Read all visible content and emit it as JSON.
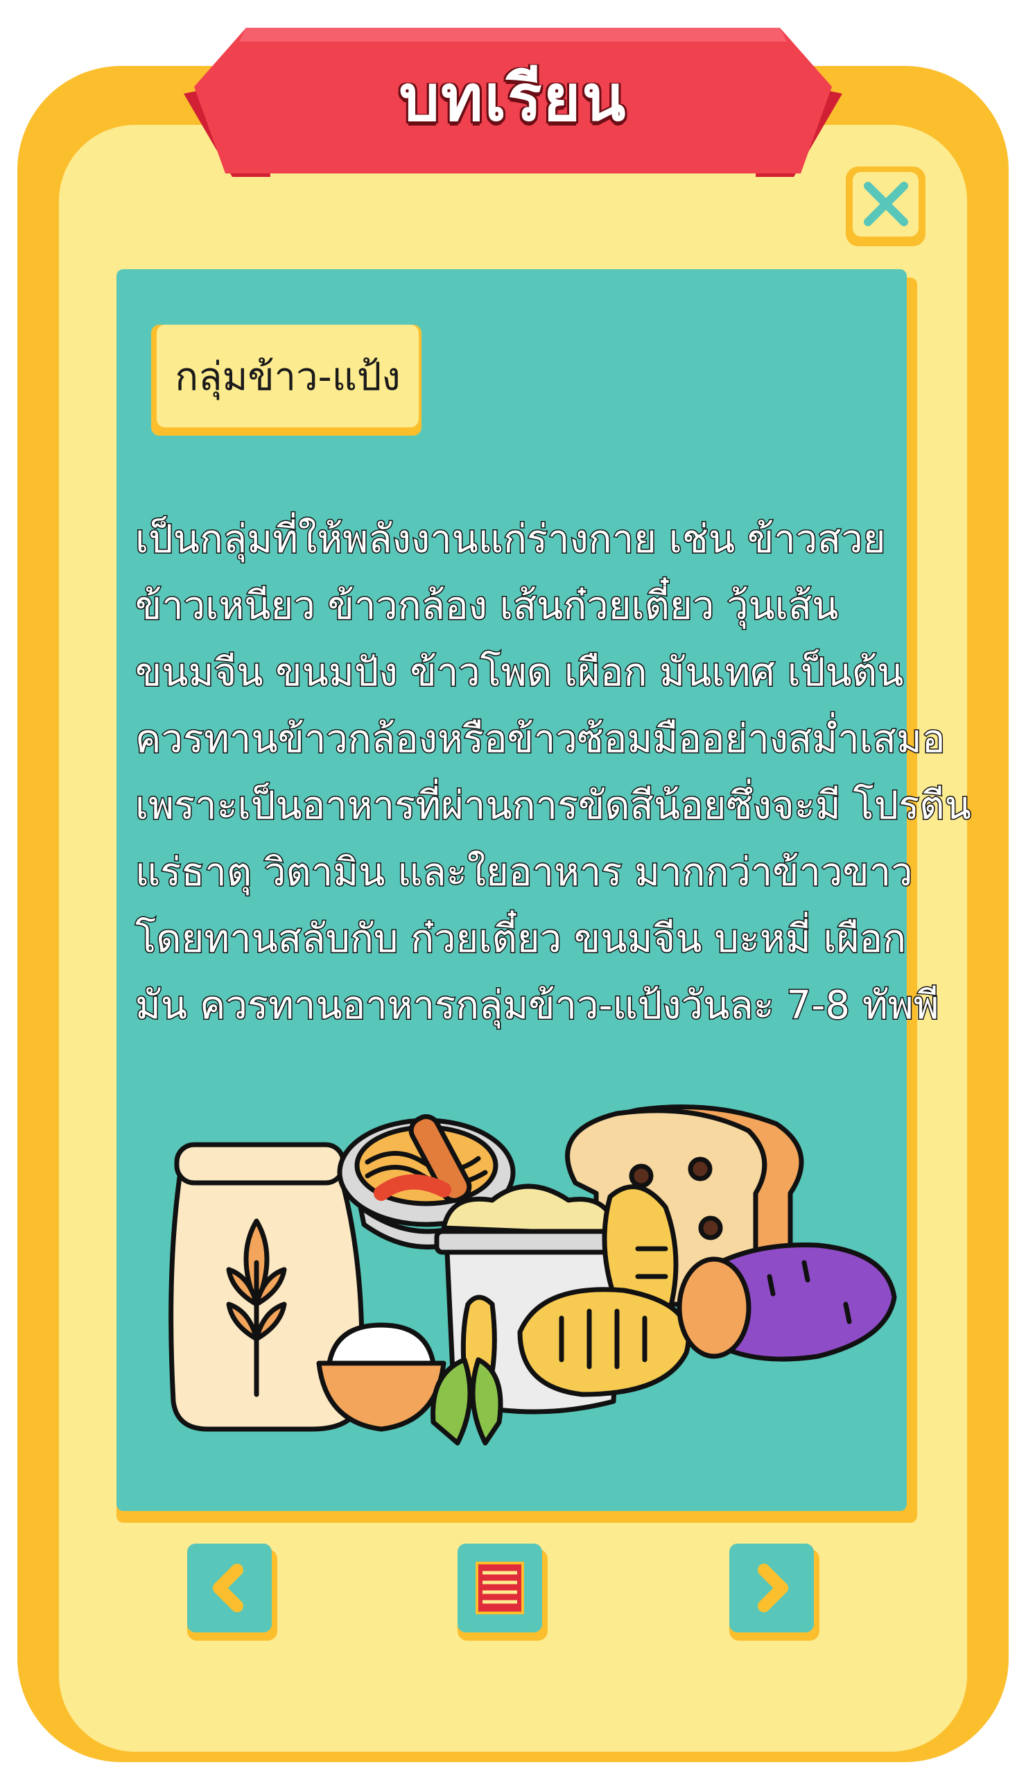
{
  "header": {
    "title": "บทเรียน"
  },
  "lesson": {
    "category": "กลุ่มข้าว-แป้ง",
    "lines": [
      "เป็นกลุ่มที่ให้พลังงานแก่ร่างกาย เช่น ข้าวสวย",
      "ข้าวเหนียว ข้าวกล้อง เส้นก๋วยเตี๋ยว วุ้นเส้น",
      "ขนมจีน ขนมปัง ข้าวโพด เผือก มันเทศ เป็นต้น",
      "ควรทานข้าวกล้องหรือข้าวซ้อมมืออย่างสม่ำเสมอ",
      "เพราะเป็นอาหารที่ผ่านการขัดสีน้อยซึ่งจะมี โปรตีน",
      "แร่ธาตุ วิตามิน และใยอาหาร มากกว่าข้าวขาว",
      "โดยทานสลับกับ ก๋วยเตี๋ยว ขนมจีน บะหมี่ เผือก",
      "มัน ควรทานอาหารกลุ่มข้าว-แป้งวันละ 7-8 ทัพพี"
    ]
  },
  "icons": {
    "close": "close-x-icon",
    "prev": "chevron-left-icon",
    "menu": "list-menu-icon",
    "next": "chevron-right-icon"
  },
  "colors": {
    "frame": "#FBBF2E",
    "frame_inner": "#FDEB8F",
    "panel": "#58C6B9",
    "ribbon": "#F0414F",
    "ribbon_dark": "#D11F34"
  }
}
